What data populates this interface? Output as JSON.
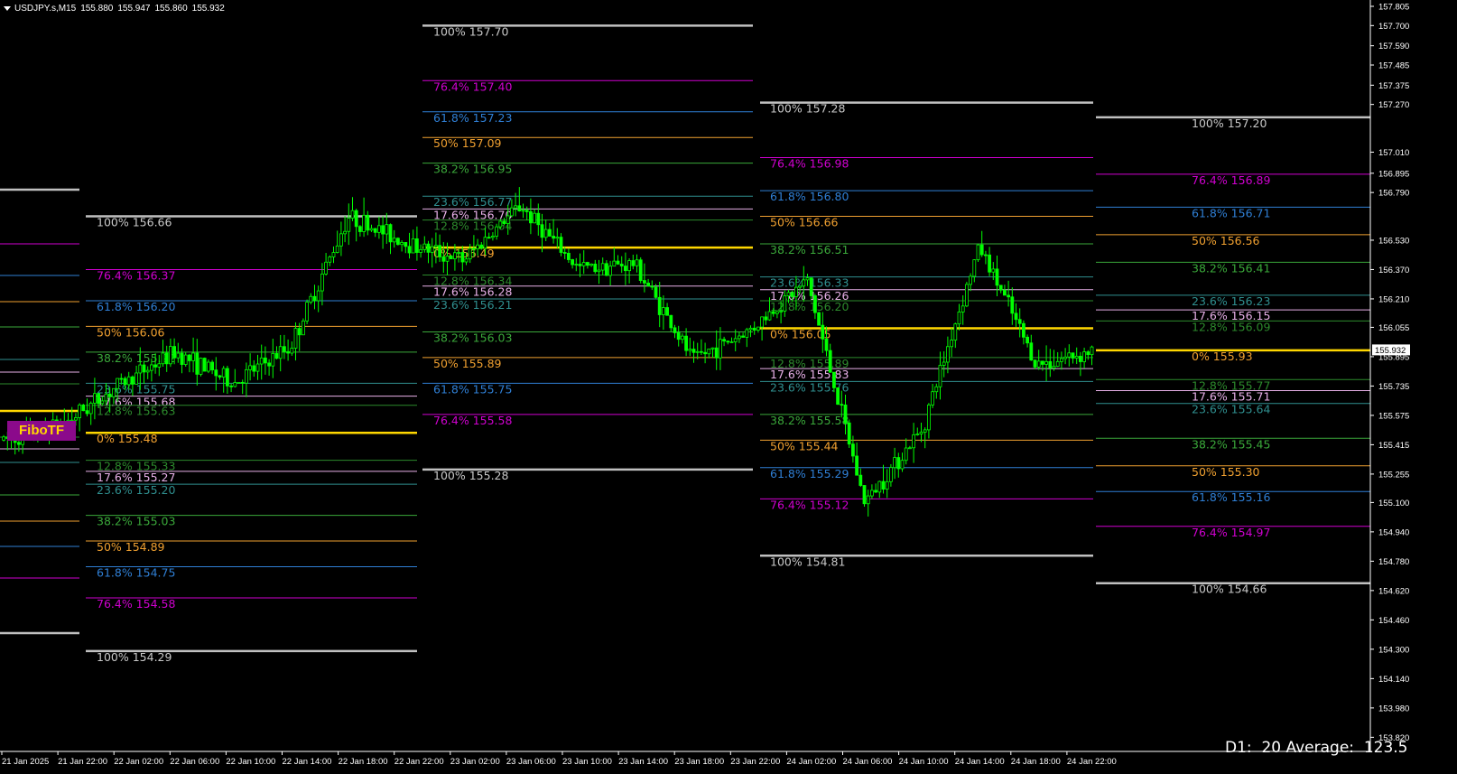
{
  "header": {
    "symbol": "USDJPY.s,M15",
    "open": "155.880",
    "high": "155.947",
    "low": "155.860",
    "close": "155.932"
  },
  "indicator_label": "FiboTF",
  "average_text": "D1:  20 Average:  123.5",
  "current_price": "155.932",
  "colors": {
    "background": "#000000",
    "candle": "#00ff00",
    "zero_line": "#ffd700",
    "hundred_line": "#c0c0c0",
    "76.4": "#d000d0",
    "61.8": "#2f7fd5",
    "50": "#f0a030",
    "38.2": "#3aa83a",
    "23.6": "#2f8f8f",
    "17.6": "#e8b0e8",
    "12.8": "#2c8a2c",
    "price_badge_bg": "#ffffff",
    "fibo_tag_bg": "#8b0a8b"
  },
  "price_axis_labels": [
    "157.805",
    "157.700",
    "157.590",
    "157.485",
    "157.375",
    "157.270",
    "157.010",
    "156.895",
    "156.790",
    "156.530",
    "156.370",
    "156.210",
    "156.055",
    "155.895",
    "155.735",
    "155.575",
    "155.415",
    "155.255",
    "155.100",
    "154.940",
    "154.780",
    "154.620",
    "154.460",
    "154.300",
    "154.140",
    "153.980",
    "153.820"
  ],
  "time_axis_labels": [
    "21 Jan 2025",
    "21 Jan 22:00",
    "22 Jan 02:00",
    "22 Jan 06:00",
    "22 Jan 10:00",
    "22 Jan 14:00",
    "22 Jan 18:00",
    "22 Jan 22:00",
    "23 Jan 02:00",
    "23 Jan 06:00",
    "23 Jan 10:00",
    "23 Jan 14:00",
    "23 Jan 18:00",
    "23 Jan 22:00",
    "24 Jan 02:00",
    "24 Jan 06:00",
    "24 Jan 10:00",
    "24 Jan 14:00",
    "24 Jan 18:00",
    "24 Jan 22:00"
  ],
  "fibo_blocks": [
    {
      "levels": [
        {
          "pct": "100%",
          "price": "156.66",
          "type": "100"
        },
        {
          "pct": "76.4%",
          "price": "156.37",
          "type": "76.4"
        },
        {
          "pct": "61.8%",
          "price": "156.20",
          "type": "61.8"
        },
        {
          "pct": "50%",
          "price": "156.06",
          "type": "50"
        },
        {
          "pct": "38.2%",
          "price": "155.92",
          "type": "38.2"
        },
        {
          "pct": "23.6%",
          "price": "155.75",
          "type": "23.6"
        },
        {
          "pct": "17.6%",
          "price": "155.68",
          "type": "17.6"
        },
        {
          "pct": "12.8%",
          "price": "155.63",
          "type": "12.8"
        },
        {
          "pct": "0%",
          "price": "155.48",
          "type": "0"
        },
        {
          "pct": "12.8%",
          "price": "155.33",
          "type": "12.8"
        },
        {
          "pct": "17.6%",
          "price": "155.27",
          "type": "17.6"
        },
        {
          "pct": "23.6%",
          "price": "155.20",
          "type": "23.6"
        },
        {
          "pct": "38.2%",
          "price": "155.03",
          "type": "38.2"
        },
        {
          "pct": "50%",
          "price": "154.89",
          "type": "50"
        },
        {
          "pct": "61.8%",
          "price": "154.75",
          "type": "61.8"
        },
        {
          "pct": "76.4%",
          "price": "154.58",
          "type": "76.4"
        },
        {
          "pct": "100%",
          "price": "154.29",
          "type": "100"
        }
      ]
    },
    {
      "levels": [
        {
          "pct": "100%",
          "price": "157.70",
          "type": "100"
        },
        {
          "pct": "76.4%",
          "price": "157.40",
          "type": "76.4"
        },
        {
          "pct": "61.8%",
          "price": "157.23",
          "type": "61.8"
        },
        {
          "pct": "50%",
          "price": "157.09",
          "type": "50"
        },
        {
          "pct": "38.2%",
          "price": "156.95",
          "type": "38.2"
        },
        {
          "pct": "23.6%",
          "price": "156.77",
          "type": "23.6"
        },
        {
          "pct": "17.6%",
          "price": "156.70",
          "type": "17.6"
        },
        {
          "pct": "12.8%",
          "price": "156.64",
          "type": "12.8"
        },
        {
          "pct": "0%",
          "price": "156.49",
          "type": "0"
        },
        {
          "pct": "12.8%",
          "price": "156.34",
          "type": "12.8"
        },
        {
          "pct": "17.6%",
          "price": "156.28",
          "type": "17.6"
        },
        {
          "pct": "23.6%",
          "price": "156.21",
          "type": "23.6"
        },
        {
          "pct": "38.2%",
          "price": "156.03",
          "type": "38.2"
        },
        {
          "pct": "50%",
          "price": "155.89",
          "type": "50"
        },
        {
          "pct": "61.8%",
          "price": "155.75",
          "type": "61.8"
        },
        {
          "pct": "76.4%",
          "price": "155.58",
          "type": "76.4"
        },
        {
          "pct": "100%",
          "price": "155.28",
          "type": "100"
        }
      ]
    },
    {
      "levels": [
        {
          "pct": "100%",
          "price": "157.28",
          "type": "100"
        },
        {
          "pct": "76.4%",
          "price": "156.98",
          "type": "76.4"
        },
        {
          "pct": "61.8%",
          "price": "156.80",
          "type": "61.8"
        },
        {
          "pct": "50%",
          "price": "156.66",
          "type": "50"
        },
        {
          "pct": "38.2%",
          "price": "156.51",
          "type": "38.2"
        },
        {
          "pct": "23.6%",
          "price": "156.33",
          "type": "23.6"
        },
        {
          "pct": "17.6%",
          "price": "156.26",
          "type": "17.6"
        },
        {
          "pct": "12.8%",
          "price": "156.20",
          "type": "12.8"
        },
        {
          "pct": "0%",
          "price": "156.05",
          "type": "0"
        },
        {
          "pct": "12.8%",
          "price": "155.89",
          "type": "12.8"
        },
        {
          "pct": "17.6%",
          "price": "155.83",
          "type": "17.6"
        },
        {
          "pct": "23.6%",
          "price": "155.76",
          "type": "23.6"
        },
        {
          "pct": "38.2%",
          "price": "155.58",
          "type": "38.2"
        },
        {
          "pct": "50%",
          "price": "155.44",
          "type": "50"
        },
        {
          "pct": "61.8%",
          "price": "155.29",
          "type": "61.8"
        },
        {
          "pct": "76.4%",
          "price": "155.12",
          "type": "76.4"
        },
        {
          "pct": "100%",
          "price": "154.81",
          "type": "100"
        }
      ]
    },
    {
      "levels": [
        {
          "pct": "100%",
          "price": "157.20",
          "type": "100"
        },
        {
          "pct": "76.4%",
          "price": "156.89",
          "type": "76.4"
        },
        {
          "pct": "61.8%",
          "price": "156.71",
          "type": "61.8"
        },
        {
          "pct": "50%",
          "price": "156.56",
          "type": "50"
        },
        {
          "pct": "38.2%",
          "price": "156.41",
          "type": "38.2"
        },
        {
          "pct": "23.6%",
          "price": "156.23",
          "type": "23.6"
        },
        {
          "pct": "17.6%",
          "price": "156.15",
          "type": "17.6"
        },
        {
          "pct": "12.8%",
          "price": "156.09",
          "type": "12.8"
        },
        {
          "pct": "0%",
          "price": "155.93",
          "type": "0"
        },
        {
          "pct": "12.8%",
          "price": "155.77",
          "type": "12.8"
        },
        {
          "pct": "17.6%",
          "price": "155.71",
          "type": "17.6"
        },
        {
          "pct": "23.6%",
          "price": "155.64",
          "type": "23.6"
        },
        {
          "pct": "38.2%",
          "price": "155.45",
          "type": "38.2"
        },
        {
          "pct": "50%",
          "price": "155.30",
          "type": "50"
        },
        {
          "pct": "61.8%",
          "price": "155.16",
          "type": "61.8"
        },
        {
          "pct": "76.4%",
          "price": "154.97",
          "type": "76.4"
        },
        {
          "pct": "100%",
          "price": "154.66",
          "type": "100"
        }
      ]
    }
  ],
  "price_path": [
    {
      "t": "21 Jan 2025",
      "price": 155.44
    },
    {
      "t": "21 Jan 22:00",
      "price": 155.52
    },
    {
      "t": "22 Jan 02:00",
      "price": 155.74
    },
    {
      "t": "22 Jan 06:00",
      "price": 155.92
    },
    {
      "t": "22 Jan 10:00",
      "price": 155.75
    },
    {
      "t": "22 Jan 14:00",
      "price": 155.95
    },
    {
      "t": "22 Jan 18:00",
      "price": 156.66
    },
    {
      "t": "22 Jan 22:00",
      "price": 156.52
    },
    {
      "t": "23 Jan 02:00",
      "price": 156.42
    },
    {
      "t": "23 Jan 06:00",
      "price": 156.72
    },
    {
      "t": "23 Jan 10:00",
      "price": 156.38
    },
    {
      "t": "23 Jan 14:00",
      "price": 156.4
    },
    {
      "t": "23 Jan 18:00",
      "price": 155.88
    },
    {
      "t": "23 Jan 22:00",
      "price": 156.04
    },
    {
      "t": "24 Jan 02:00",
      "price": 156.31
    },
    {
      "t": "24 Jan 06:00",
      "price": 155.1
    },
    {
      "t": "24 Jan 10:00",
      "price": 155.5
    },
    {
      "t": "24 Jan 14:00",
      "price": 156.5
    },
    {
      "t": "24 Jan 18:00",
      "price": 155.85
    },
    {
      "t": "24 Jan 22:00",
      "price": 155.93
    }
  ]
}
